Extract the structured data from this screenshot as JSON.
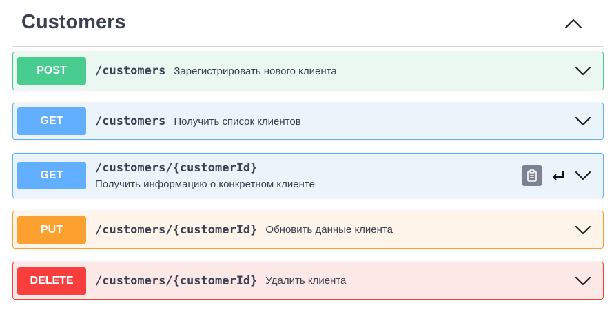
{
  "section": {
    "title": "Customers",
    "collapse_icon": "chevron-up-icon"
  },
  "operations": [
    {
      "method": "POST",
      "path": "/customers",
      "summary": "Зарегистрировать нового клиента",
      "bg": "#ebf8f2",
      "border": "#49cc90",
      "method_bg": "#49cc90"
    },
    {
      "method": "GET",
      "path": "/customers",
      "summary": "Получить список клиентов",
      "bg": "#ebf3fb",
      "border": "#61affe",
      "method_bg": "#61affe"
    },
    {
      "method": "GET",
      "path": "/customers/{customerId}",
      "summary": "Получить информацию о конкретном клиенте",
      "bg": "#ebf3fb",
      "border": "#61affe",
      "method_bg": "#61affe",
      "icons": [
        "copy-to-clipboard-icon",
        "enter-icon"
      ]
    },
    {
      "method": "PUT",
      "path": "/customers/{customerId}",
      "summary": "Обновить данные клиента",
      "bg": "#fff4e9",
      "border": "#fca130",
      "method_bg": "#fca130"
    },
    {
      "method": "DELETE",
      "path": "/customers/{customerId}",
      "summary": "Удалить клиента",
      "bg": "#fde8e8",
      "border": "#f93e3e",
      "method_bg": "#f93e3e"
    }
  ]
}
